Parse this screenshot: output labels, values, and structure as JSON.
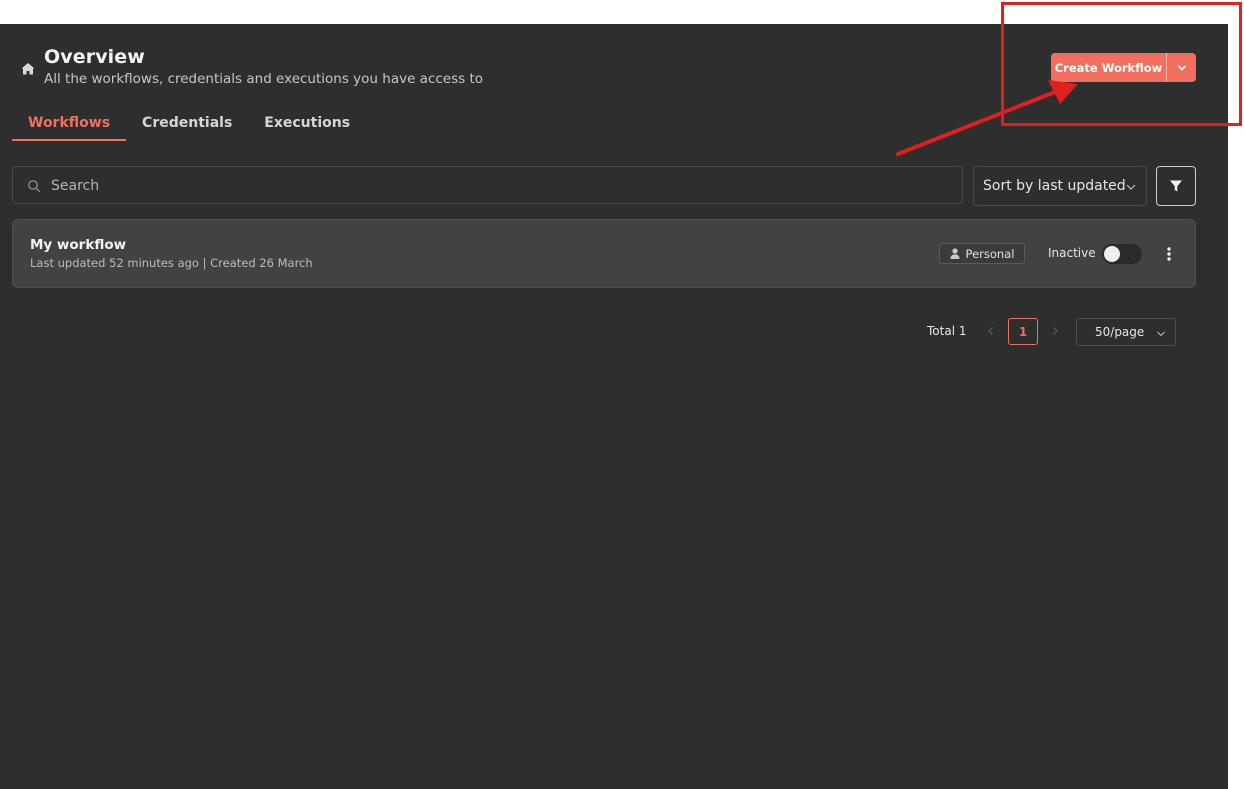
{
  "header": {
    "title": "Overview",
    "subtitle": "All the workflows, credentials and executions you have access to",
    "icon": "home-icon"
  },
  "create_button": {
    "label": "Create Workflow",
    "caret_icon": "chevron-down-icon"
  },
  "tabs": [
    {
      "label": "Workflows",
      "active": true
    },
    {
      "label": "Credentials",
      "active": false
    },
    {
      "label": "Executions",
      "active": false
    }
  ],
  "search": {
    "placeholder": "Search",
    "value": ""
  },
  "sort": {
    "selected": "Sort by last updated"
  },
  "filter": {
    "icon": "filter-icon"
  },
  "workflows": [
    {
      "name": "My workflow",
      "meta": "Last updated 52 minutes ago | Created 26 March",
      "owner_badge": "Personal",
      "status_label": "Inactive",
      "active": false
    }
  ],
  "pagination": {
    "total_label": "Total 1",
    "current_page": "1",
    "page_size": "50/page"
  },
  "colors": {
    "accent": "#f16f5c",
    "background": "#2d2e2e",
    "card": "#414244",
    "annotation": "#e0201c"
  }
}
